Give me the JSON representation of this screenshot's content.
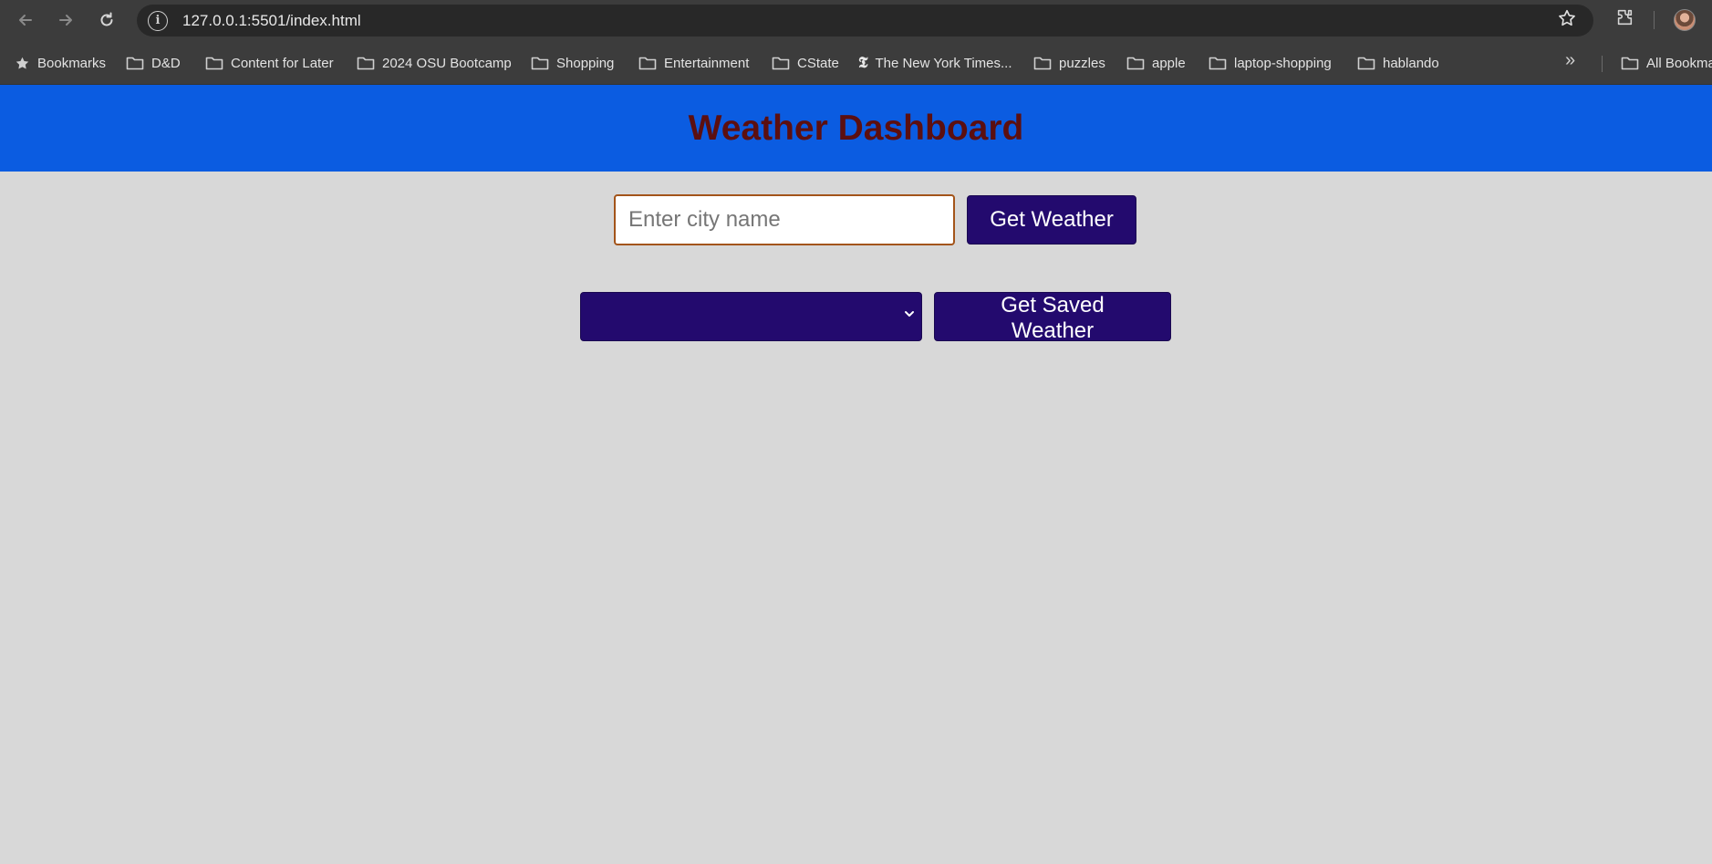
{
  "browser": {
    "url": "127.0.0.1:5501/index.html",
    "icons": [
      "back-arrow-icon",
      "forward-arrow-icon",
      "reload-icon",
      "site-info-icon",
      "star-icon",
      "extensions-icon",
      "profile-avatar"
    ]
  },
  "bookmarks": {
    "items": [
      {
        "label": "Bookmarks",
        "icon": "star-icon"
      },
      {
        "label": "D&D",
        "icon": "folder-icon"
      },
      {
        "label": "Content for Later",
        "icon": "folder-icon"
      },
      {
        "label": "2024 OSU Bootcamp",
        "icon": "folder-icon"
      },
      {
        "label": "Shopping",
        "icon": "folder-icon"
      },
      {
        "label": "Entertainment",
        "icon": "folder-icon"
      },
      {
        "label": "CState",
        "icon": "folder-icon"
      },
      {
        "label": "The New York Times...",
        "icon": "nyt-icon"
      },
      {
        "label": "puzzles",
        "icon": "folder-icon"
      },
      {
        "label": "apple",
        "icon": "folder-icon"
      },
      {
        "label": "laptop-shopping",
        "icon": "folder-icon"
      },
      {
        "label": "hablando",
        "icon": "folder-icon"
      }
    ],
    "all_bookmarks": "All Bookma"
  },
  "page": {
    "title": "Weather Dashboard",
    "search": {
      "placeholder": "Enter city name",
      "value": "",
      "button_label": "Get Weather"
    },
    "saved": {
      "selected": "",
      "button_label": "Get Saved Weather"
    }
  },
  "colors": {
    "header_bg": "#0b5ce1",
    "title": "#5c0f10",
    "button_bg": "#230a6e",
    "page_bg": "#d8d8d8",
    "input_border": "#a3541a"
  }
}
